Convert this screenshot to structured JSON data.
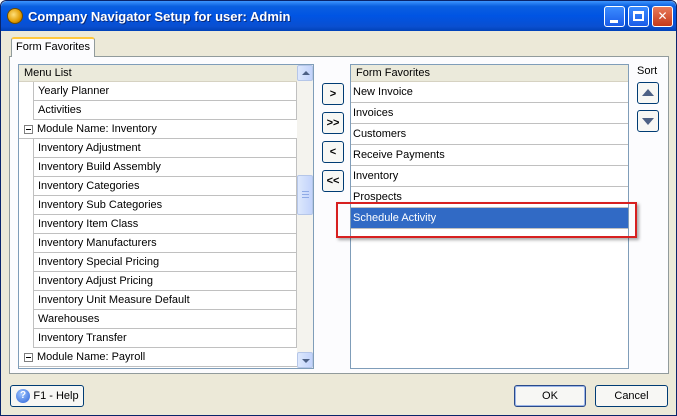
{
  "window": {
    "title": "Company Navigator Setup for user: Admin",
    "minimize_glyph": "",
    "maximize_glyph": "",
    "close_glyph": "✕"
  },
  "tabs": [
    {
      "label": "Form Favorites",
      "active": true
    }
  ],
  "menu_list": {
    "header": "Menu List",
    "rows": [
      {
        "type": "item",
        "label": "Yearly Planner"
      },
      {
        "type": "item",
        "label": "Activities"
      },
      {
        "type": "module",
        "label": "Module Name: Inventory"
      },
      {
        "type": "item",
        "label": "Inventory Adjustment"
      },
      {
        "type": "item",
        "label": "Inventory Build Assembly"
      },
      {
        "type": "item",
        "label": "Inventory Categories"
      },
      {
        "type": "item",
        "label": "Inventory Sub Categories"
      },
      {
        "type": "item",
        "label": "Inventory Item Class"
      },
      {
        "type": "item",
        "label": "Inventory Manufacturers"
      },
      {
        "type": "item",
        "label": "Inventory Special Pricing"
      },
      {
        "type": "item",
        "label": "Inventory Adjust Pricing"
      },
      {
        "type": "item",
        "label": "Inventory Unit Measure Default"
      },
      {
        "type": "item",
        "label": "Warehouses"
      },
      {
        "type": "item",
        "label": "Inventory Transfer"
      },
      {
        "type": "module",
        "label": "Module Name: Payroll"
      }
    ]
  },
  "move_buttons": {
    "add": ">",
    "add_all": ">>",
    "remove": "<",
    "remove_all": "<<"
  },
  "form_favorites": {
    "header": "Form Favorites",
    "rows": [
      {
        "label": "New Invoice",
        "selected": false
      },
      {
        "label": "Invoices",
        "selected": false
      },
      {
        "label": "Customers",
        "selected": false
      },
      {
        "label": "Receive Payments",
        "selected": false
      },
      {
        "label": "Inventory",
        "selected": false
      },
      {
        "label": "Prospects",
        "selected": false
      },
      {
        "label": "Schedule Activity",
        "selected": true
      }
    ]
  },
  "sort": {
    "label": "Sort"
  },
  "footer": {
    "help_label": "F1 - Help",
    "help_icon_glyph": "?",
    "ok_label": "OK",
    "cancel_label": "Cancel"
  },
  "colors": {
    "selection": "#316ac5",
    "highlight_border": "#d72020",
    "titlebar": "#0054e3"
  }
}
